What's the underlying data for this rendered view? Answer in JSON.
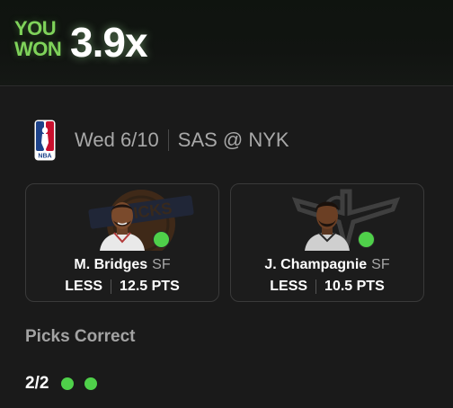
{
  "header": {
    "you_won_label": "YOU WON",
    "multiplier": "3.9x"
  },
  "game": {
    "league_icon": "nba-logo-icon",
    "date": "Wed 6/10",
    "matchup": "SAS @ NYK"
  },
  "picks": [
    {
      "player_name": "M. Bridges",
      "position": "SF",
      "direction": "LESS",
      "line": "12.5 PTS",
      "team_icon": "knicks-logo-icon",
      "result": "correct"
    },
    {
      "player_name": "J. Champagnie",
      "position": "SF",
      "direction": "LESS",
      "line": "10.5 PTS",
      "team_icon": "spurs-logo-icon",
      "result": "correct"
    }
  ],
  "summary": {
    "title": "Picks Correct",
    "count": "2/2"
  },
  "colors": {
    "win_green": "#7fd35a",
    "dot_green": "#4fd04a",
    "background": "#1a1a1a"
  }
}
